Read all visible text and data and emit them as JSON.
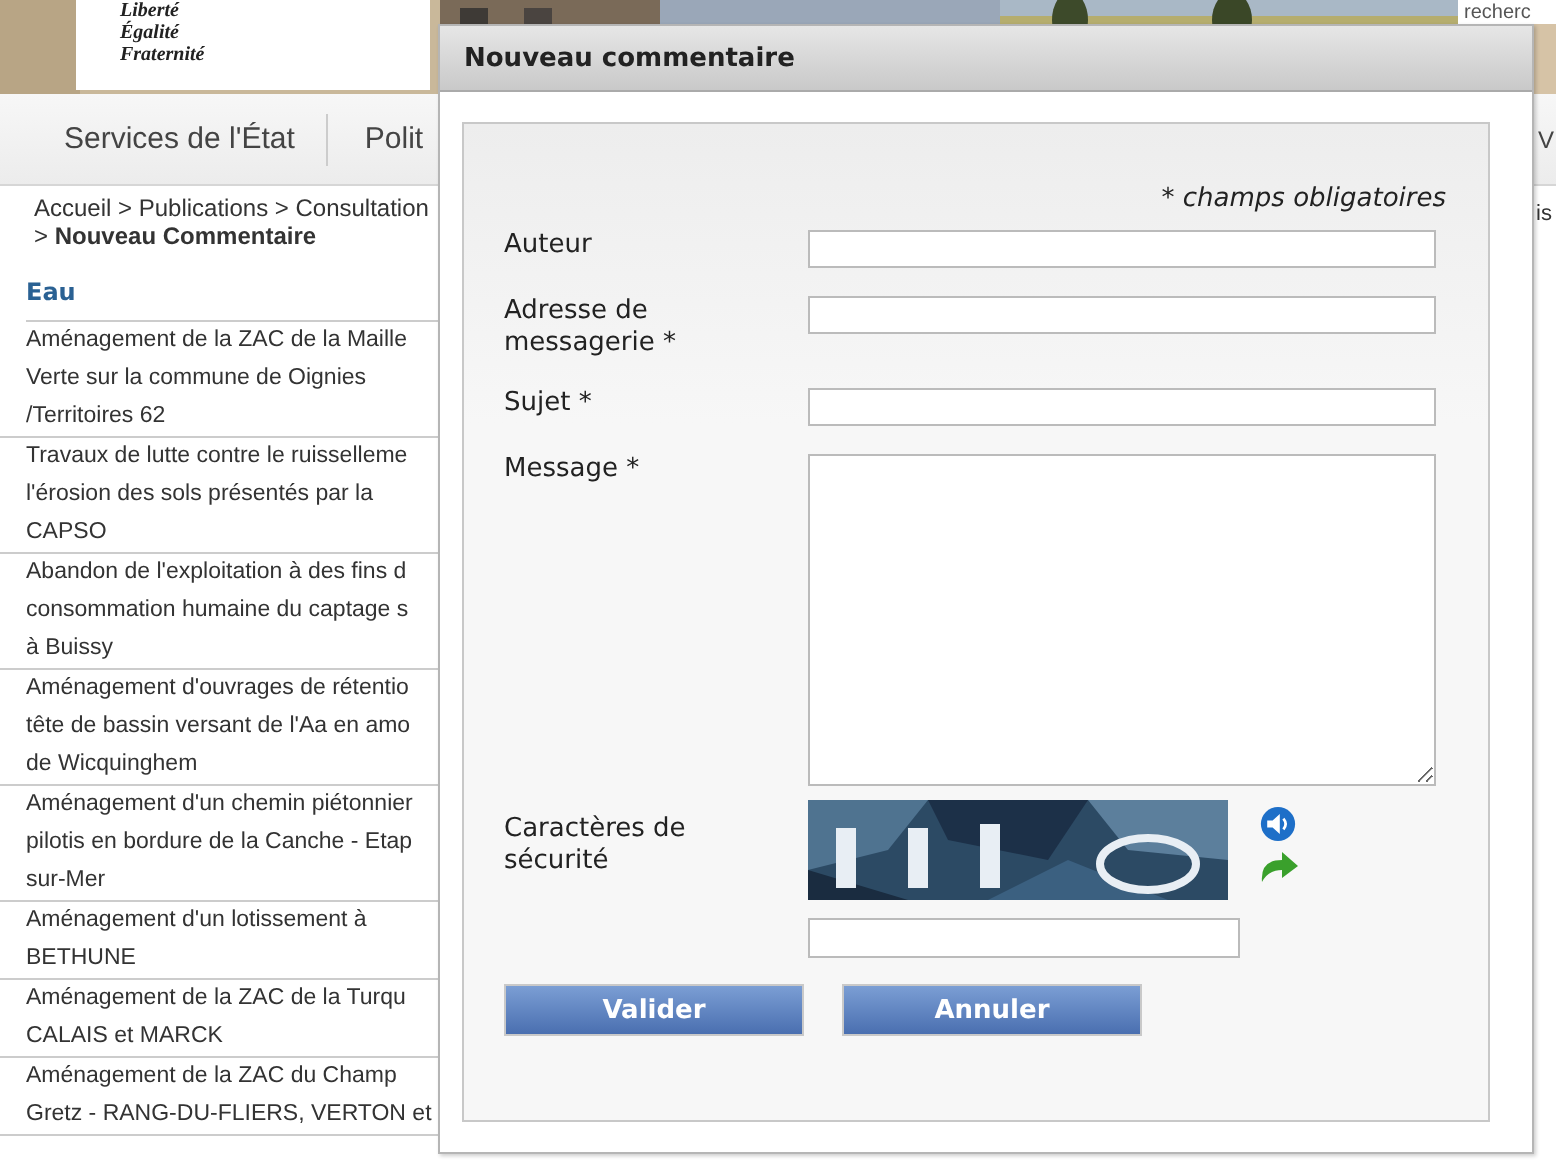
{
  "header": {
    "logo_lines": [
      "Liberté",
      "Égalité",
      "Fraternité"
    ],
    "search": {
      "placeholder": "recherc"
    }
  },
  "nav": {
    "items": [
      "Services de l'État",
      "Polit"
    ],
    "edge_item": "V"
  },
  "breadcrumb": [
    "Accueil > Publications > Consultation",
    "> **Nouveau Commentaire**"
  ],
  "edge_text": "is",
  "section": {
    "title": "Eau",
    "items": [
      {
        "lines": [
          "Aménagement de la ZAC de la Maille",
          "Verte sur la commune de Oignies",
          "/Territoires 62"
        ]
      },
      {
        "lines": [
          "Travaux de lutte contre le ruisselleme",
          "l'érosion des sols présentés par la",
          "CAPSO"
        ]
      },
      {
        "lines": [
          "Abandon de l'exploitation à des fins d",
          "consommation humaine du captage s",
          "à Buissy"
        ]
      },
      {
        "lines": [
          "Aménagement d'ouvrages de rétentio",
          "tête de bassin versant de l'Aa en amo",
          "de Wicquinghem"
        ]
      },
      {
        "lines": [
          "Aménagement d'un chemin piétonnier",
          "pilotis en bordure de la Canche - Etap",
          "sur-Mer"
        ]
      },
      {
        "lines": [
          "Aménagement d'un lotissement à",
          "BETHUNE"
        ]
      },
      {
        "lines": [
          "Aménagement de la ZAC de la Turqu",
          "CALAIS et MARCK"
        ]
      },
      {
        "lines": [
          "Aménagement de la ZAC du Champ",
          "Gretz - RANG-DU-FLIERS, VERTON et"
        ]
      }
    ]
  },
  "dialog": {
    "title": "Nouveau commentaire",
    "required_note": "* champs obligatoires",
    "fields": [
      {
        "label": "Auteur",
        "kind": "text"
      },
      {
        "label": "Adresse de messagerie *",
        "kind": "text"
      },
      {
        "label": "Sujet *",
        "kind": "text"
      },
      {
        "label": "Message *",
        "kind": "textarea"
      },
      {
        "label": "Caractères de sécurité",
        "kind": "captcha"
      }
    ],
    "buttons": [
      "Valider",
      "Annuler"
    ]
  }
}
